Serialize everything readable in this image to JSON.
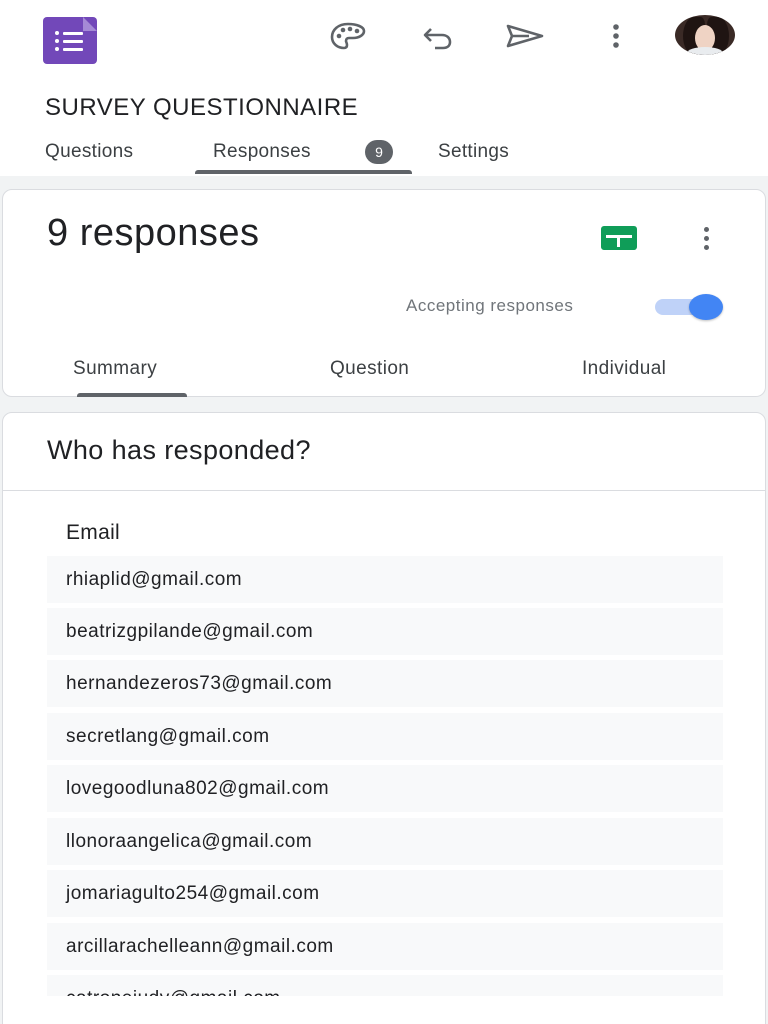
{
  "app": {
    "form_title": "SURVEY QUESTIONNAIRE",
    "brand_color": "#7248b9"
  },
  "toolbar": {
    "icons": [
      "palette-icon",
      "undo-icon",
      "send-icon",
      "more-vert-icon"
    ],
    "avatar": "user-avatar"
  },
  "tabs": [
    {
      "label": "Questions",
      "active": false
    },
    {
      "label": "Responses",
      "active": true,
      "badge": "9"
    },
    {
      "label": "Settings",
      "active": false
    }
  ],
  "responses": {
    "count_label": "9 responses",
    "accepting_label": "Accepting responses",
    "accepting_on": true,
    "toggle_color": "#4285f4",
    "sheets_color": "#0f9d58",
    "subtabs": [
      {
        "label": "Summary",
        "active": true
      },
      {
        "label": "Question",
        "active": false
      },
      {
        "label": "Individual",
        "active": false
      }
    ]
  },
  "who": {
    "title": "Who has responded?",
    "column_header": "Email",
    "emails": [
      "rhiaplid@gmail.com",
      "beatrizgpilande@gmail.com",
      "hernandezeros73@gmail.com",
      "secretlang@gmail.com",
      "lovegoodluna802@gmail.com",
      "llonoraangelica@gmail.com",
      "jomariagulto254@gmail.com",
      "arcillarachelleann@gmail.com",
      "catronejudy@gmail.com"
    ]
  }
}
